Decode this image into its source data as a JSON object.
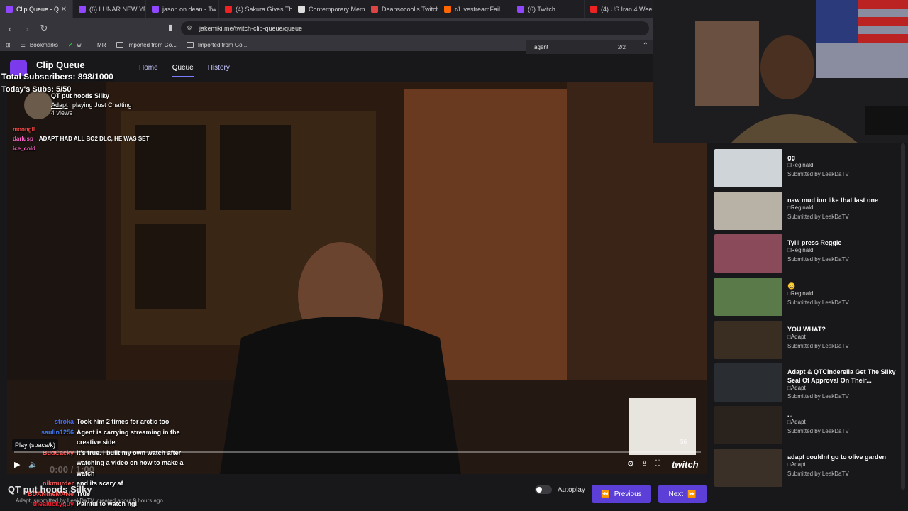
{
  "browser": {
    "tabs": [
      {
        "title": "Clip Queue - Q",
        "color": "#9146ff",
        "active": true
      },
      {
        "title": "(6) LUNAR NEW YE",
        "color": "#9146ff"
      },
      {
        "title": "jason on dean - Tw",
        "color": "#9146ff"
      },
      {
        "title": "(4) Sakura Gives Th",
        "color": "#e22"
      },
      {
        "title": "Contemporary Mem",
        "color": "#ddd"
      },
      {
        "title": "Deansocool's Twitch",
        "color": "#d44"
      },
      {
        "title": "r/LivestreamFail",
        "color": "#f60"
      },
      {
        "title": "(6) Twitch",
        "color": "#9146ff"
      },
      {
        "title": "(4) US Iran 4 Week",
        "color": "#e22"
      }
    ],
    "url": "jakemiki.me/twitch-clip-queue/queue",
    "bookmarks": [
      {
        "label": "Bookmarks",
        "icon": "star-icon"
      },
      {
        "label": "w",
        "icon": "w-icon"
      },
      {
        "label": "MR",
        "icon": "mr-icon"
      },
      {
        "label": "Imported from Go...",
        "icon": "folder-icon"
      },
      {
        "label": "Imported from Go...",
        "icon": "folder-icon"
      }
    ],
    "find": {
      "query": "agent",
      "count": "2/2"
    }
  },
  "app": {
    "title": "Clip Queue",
    "nav": [
      "Home",
      "Queue",
      "History"
    ],
    "active_nav": "Queue"
  },
  "overlay": {
    "subs": "Total Subscribers: 898/1000",
    "today": "Today's Subs: 5/50",
    "clip_title": "QT put hoods Silky",
    "clip_broadcaster": "Adapt",
    "clip_game": "playing Just Chatting",
    "clip_views": "4 views",
    "top_chat": [
      {
        "user": "moongil",
        "msg": ""
      },
      {
        "user": "darlusp",
        "msg": "ADAPT HAD ALL BO2 DLC, HE WAS SET"
      },
      {
        "user": "ice_cold",
        "msg": ""
      }
    ],
    "chat": [
      {
        "user": "stroka",
        "msg": "Took him 2 times for arctic too",
        "color": "#4a6cf0"
      },
      {
        "user": "saulin1256",
        "msg": "Agent is carrying streaming in the creative side",
        "color": "#3f7cf0"
      },
      {
        "user": "BudCacky",
        "msg": "It's true. I built my own watch after watching a video on how to make a watch",
        "color": "#ff4d4d"
      },
      {
        "user": "nikmurder",
        "msg": "and its scary af",
        "color": "#ff5c5c"
      },
      {
        "user": "BDANtheMANe",
        "msg": "True",
        "color": "#ff4d4d"
      },
      {
        "user": "thealuckyguy",
        "msg": "Painful to watch ngl",
        "color": "#e23"
      }
    ]
  },
  "player": {
    "tooltip": "Play (space/k)",
    "time": "0:00 / 1:00",
    "brand": "twitch",
    "timestamp_badge": "56"
  },
  "current_clip": {
    "title": "QT put hoods Silky",
    "meta": "Adapt, submitted by LeakDaTV, created about 9 hours ago"
  },
  "controls": {
    "autoplay_label": "Autoplay",
    "autoplay_on": false,
    "previous_label": "Previous",
    "next_label": "Next"
  },
  "queue": [
    {
      "title": "gg",
      "broadcaster": "Reginald",
      "submitted": "Submitted by LeakDaTV",
      "color": "#cfd4d8"
    },
    {
      "title": "naw mud ion like that last one",
      "broadcaster": "Reginald",
      "submitted": "Submitted by LeakDaTV",
      "color": "#b8b2a6"
    },
    {
      "title": "Tylil press Reggie",
      "broadcaster": "Reginald",
      "submitted": "Submitted by LeakDaTV",
      "color": "#8a4a5a"
    },
    {
      "title": "😄",
      "broadcaster": "Reginald",
      "submitted": "Submitted by LeakDaTV",
      "color": "#5a7a4a"
    },
    {
      "title": "YOU WHAT?",
      "broadcaster": "Adapt",
      "submitted": "Submitted by LeakDaTV",
      "color": "#3a2e22"
    },
    {
      "title": "Adapt & QTCinderella Get The Silky Seal Of Approval On Their...",
      "broadcaster": "Adapt",
      "submitted": "Submitted by LeakDaTV",
      "color": "#2a2e32"
    },
    {
      "title": "...",
      "broadcaster": "Adapt",
      "submitted": "Submitted by LeakDaTV",
      "color": "#2a221c"
    },
    {
      "title": "adapt couldnt go to olive garden",
      "broadcaster": "Adapt",
      "submitted": "Submitted by LeakDaTV",
      "color": "#3a3028"
    }
  ],
  "colors": {
    "accent": "#5b3fd6",
    "brand": "#9146ff"
  }
}
